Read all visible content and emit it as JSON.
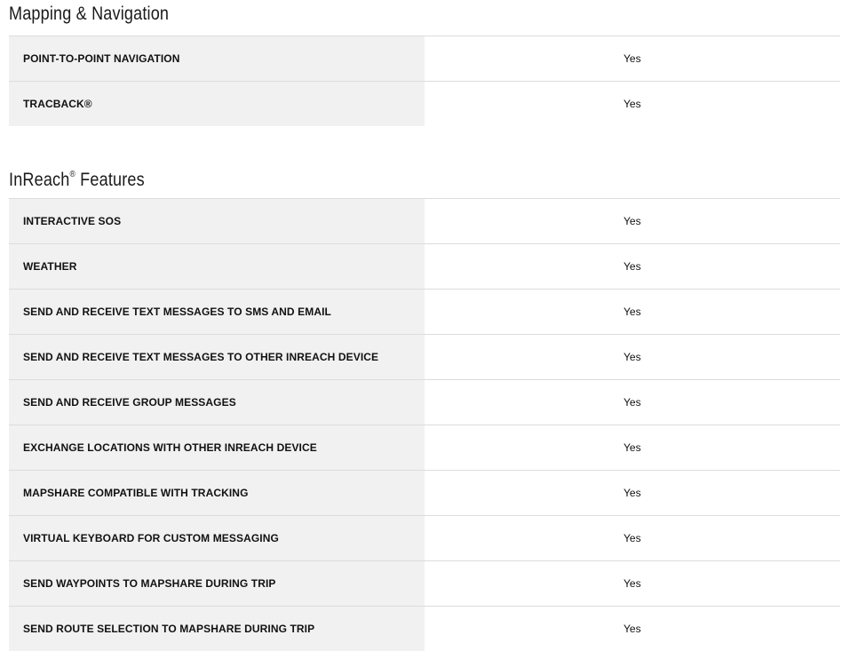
{
  "sections": [
    {
      "title": "Mapping & Navigation",
      "rows": [
        {
          "label": "POINT-TO-POINT NAVIGATION",
          "value": "Yes"
        },
        {
          "label": "TRACBACK®",
          "value": "Yes"
        }
      ]
    },
    {
      "title": "InReach",
      "title_mark": "®",
      "title_suffix": " Features",
      "rows": [
        {
          "label": "INTERACTIVE SOS",
          "value": "Yes"
        },
        {
          "label": "WEATHER",
          "value": "Yes"
        },
        {
          "label": "SEND AND RECEIVE TEXT MESSAGES TO SMS AND EMAIL",
          "value": "Yes"
        },
        {
          "label": "SEND AND RECEIVE TEXT MESSAGES TO OTHER INREACH DEVICE",
          "value": "Yes"
        },
        {
          "label": "SEND AND RECEIVE GROUP MESSAGES",
          "value": "Yes"
        },
        {
          "label": "EXCHANGE LOCATIONS WITH OTHER INREACH DEVICE",
          "value": "Yes"
        },
        {
          "label": "MAPSHARE COMPATIBLE WITH TRACKING",
          "value": "Yes"
        },
        {
          "label": "VIRTUAL KEYBOARD FOR CUSTOM MESSAGING",
          "value": "Yes"
        },
        {
          "label": "SEND WAYPOINTS TO MAPSHARE DURING TRIP",
          "value": "Yes"
        },
        {
          "label": "SEND ROUTE SELECTION TO MAPSHARE DURING TRIP",
          "value": "Yes"
        }
      ]
    }
  ]
}
